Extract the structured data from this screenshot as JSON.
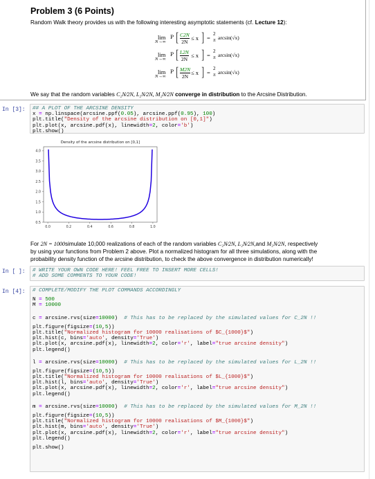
{
  "problem": {
    "title": "Problem 3 (6 Points)",
    "intro_prefix": "Random Walk theory provides us with the following interesting asymptotic statements (cf. ",
    "intro_bold": "Lecture 12",
    "intro_suffix": "):",
    "equations": [
      {
        "lim": "lim",
        "limsub": "N→∞",
        "prob": "P",
        "numerator": "C2N",
        "denominator": "2N",
        "relation": "≤ x",
        "equals": "=",
        "rhs_num": "2",
        "rhs_den": "π",
        "rhs_func": "arcsin(√x)"
      },
      {
        "lim": "lim",
        "limsub": "N→∞",
        "prob": "P",
        "numerator": "L2N",
        "denominator": "2N",
        "relation": "≤ x",
        "equals": "=",
        "rhs_num": "2",
        "rhs_den": "π",
        "rhs_func": "arcsin(√x)"
      },
      {
        "lim": "lim",
        "limsub": "N→∞",
        "prob": "P",
        "numerator": "M2N",
        "denominator": "2N",
        "relation": "≤ x",
        "equals": "=",
        "rhs_num": "2",
        "rhs_den": "π",
        "rhs_func": "arcsin(√x)"
      }
    ],
    "convergence_prefix": "We say that the random variables ",
    "convergence_vars": "C₂N⁄2N, L₂N⁄2N, M₂N⁄2N",
    "convergence_bold": "converge in distribution",
    "convergence_suffix": " to the Arcsine Distribution."
  },
  "cells": {
    "cell3": {
      "prompt": "In [3]:",
      "lines": [
        [
          {
            "t": "## A PLOT OF THE ARCSINE DENSITY",
            "c": "cm"
          }
        ],
        [
          {
            "t": "x "
          },
          {
            "t": "=",
            "c": "op"
          },
          {
            "t": " np.linspace(arcsine.ppf("
          },
          {
            "t": "0.05",
            "c": "num"
          },
          {
            "t": "), arcsine.ppf("
          },
          {
            "t": "0.95",
            "c": "num"
          },
          {
            "t": "), "
          },
          {
            "t": "100",
            "c": "num"
          },
          {
            "t": ")"
          }
        ],
        [
          {
            "t": "plt.title("
          },
          {
            "t": "\"Density of the arcsine distribution on [0,1]\"",
            "c": "str"
          },
          {
            "t": ")"
          }
        ],
        [
          {
            "t": "plt.plot(x, arcsine.pdf(x), linewidth"
          },
          {
            "t": "=",
            "c": "op"
          },
          {
            "t": "2",
            "c": "num"
          },
          {
            "t": ", color"
          },
          {
            "t": "=",
            "c": "op"
          },
          {
            "t": "'b'",
            "c": "str"
          },
          {
            "t": ")"
          }
        ],
        [
          {
            "t": "plt.show()"
          }
        ]
      ]
    },
    "task_text": {
      "prefix": "For ",
      "math1": "2N = 1000",
      "mid1": "simulate 10,000 realizations of each of the random variables ",
      "vars": "C₂N⁄2N, L₂N⁄2N,",
      "and": "and ",
      "var3": "M₂N⁄2N",
      "line1_end": ", respectively",
      "line2": "by using your functions from Problem 2 above. Plot a normalized histogram for all three simulations, along with the",
      "line3": "probability density function of the arcsine distribution, to check the above convergence in distribution numerically!"
    },
    "cell_empty": {
      "prompt": "In [ ]:",
      "lines": [
        [
          {
            "t": "# WRITE YOUR OWN CODE HERE! FEEL FREE TO INSERT MORE CELLS!",
            "c": "cm"
          }
        ],
        [
          {
            "t": "# ADD SOME COMMENTS TO YOUR CODE!",
            "c": "cm"
          }
        ]
      ]
    },
    "cell4": {
      "prompt": "In [4]:",
      "lines": [
        [
          {
            "t": "# COMPLETE/MODIFY THE PLOT COMMANDS ACCORDINGLY",
            "c": "cm"
          }
        ],
        [],
        [
          {
            "t": "N "
          },
          {
            "t": "=",
            "c": "op"
          },
          {
            "t": " "
          },
          {
            "t": "500",
            "c": "num"
          }
        ],
        [
          {
            "t": "M "
          },
          {
            "t": "=",
            "c": "op"
          },
          {
            "t": " "
          },
          {
            "t": "10000",
            "c": "num"
          }
        ],
        [],
        [],
        [
          {
            "t": "c "
          },
          {
            "t": "=",
            "c": "op"
          },
          {
            "t": " arcsine.rvs(size"
          },
          {
            "t": "=",
            "c": "op"
          },
          {
            "t": "10000",
            "c": "num"
          },
          {
            "t": ")  "
          },
          {
            "t": "# This has to be replaced by the simulated values for C_2N !!",
            "c": "cm"
          }
        ],
        [],
        [
          {
            "t": "plt.figure(figsize"
          },
          {
            "t": "=",
            "c": "op"
          },
          {
            "t": "("
          },
          {
            "t": "10",
            "c": "num"
          },
          {
            "t": ","
          },
          {
            "t": "5",
            "c": "num"
          },
          {
            "t": "))"
          }
        ],
        [
          {
            "t": "plt.title("
          },
          {
            "t": "\"Normalized histogram for 10000 realisations of $C_{1000}$\"",
            "c": "str"
          },
          {
            "t": ")"
          }
        ],
        [
          {
            "t": "plt.hist(c, bins"
          },
          {
            "t": "=",
            "c": "op"
          },
          {
            "t": "'auto'",
            "c": "str"
          },
          {
            "t": ", density"
          },
          {
            "t": "=",
            "c": "op"
          },
          {
            "t": "'True'",
            "c": "str"
          },
          {
            "t": ")"
          }
        ],
        [
          {
            "t": "plt.plot(x, arcsine.pdf(x), linewidth"
          },
          {
            "t": "=",
            "c": "op"
          },
          {
            "t": "2",
            "c": "num"
          },
          {
            "t": ", color"
          },
          {
            "t": "=",
            "c": "op"
          },
          {
            "t": "'r'",
            "c": "str"
          },
          {
            "t": ", label"
          },
          {
            "t": "=",
            "c": "op"
          },
          {
            "t": "\"true arcsine density\"",
            "c": "str"
          },
          {
            "t": ")"
          }
        ],
        [
          {
            "t": "plt.legend()"
          }
        ],
        [],
        [],
        [
          {
            "t": "l "
          },
          {
            "t": "=",
            "c": "op"
          },
          {
            "t": " arcsine.rvs(size"
          },
          {
            "t": "=",
            "c": "op"
          },
          {
            "t": "10000",
            "c": "num"
          },
          {
            "t": ")  "
          },
          {
            "t": "# This has to be replaced by the simulated values for L_2N !!",
            "c": "cm"
          }
        ],
        [],
        [
          {
            "t": "plt.figure(figsize"
          },
          {
            "t": "=",
            "c": "op"
          },
          {
            "t": "("
          },
          {
            "t": "10",
            "c": "num"
          },
          {
            "t": ","
          },
          {
            "t": "5",
            "c": "num"
          },
          {
            "t": "))"
          }
        ],
        [
          {
            "t": "plt.title("
          },
          {
            "t": "\"Normalized histogram for 10000 realisations of $L_{1000}$\"",
            "c": "str"
          },
          {
            "t": ")"
          }
        ],
        [
          {
            "t": "plt.hist(l, bins"
          },
          {
            "t": "=",
            "c": "op"
          },
          {
            "t": "'auto'",
            "c": "str"
          },
          {
            "t": ", density"
          },
          {
            "t": "=",
            "c": "op"
          },
          {
            "t": "'True'",
            "c": "str"
          },
          {
            "t": ")"
          }
        ],
        [
          {
            "t": "plt.plot(x, arcsine.pdf(x), linewidth"
          },
          {
            "t": "=",
            "c": "op"
          },
          {
            "t": "2",
            "c": "num"
          },
          {
            "t": ", color"
          },
          {
            "t": "=",
            "c": "op"
          },
          {
            "t": "'r'",
            "c": "str"
          },
          {
            "t": ", label"
          },
          {
            "t": "=",
            "c": "op"
          },
          {
            "t": "\"true arcsine density\"",
            "c": "str"
          },
          {
            "t": ")"
          }
        ],
        [
          {
            "t": "plt.legend()"
          }
        ],
        [],
        [],
        [
          {
            "t": "m "
          },
          {
            "t": "=",
            "c": "op"
          },
          {
            "t": " arcsine.rvs(size"
          },
          {
            "t": "=",
            "c": "op"
          },
          {
            "t": "10000",
            "c": "num"
          },
          {
            "t": ")  "
          },
          {
            "t": "# This has to be replaced by the simulated values for M_2N !!",
            "c": "cm"
          }
        ],
        [],
        [
          {
            "t": "plt.figure(figsize"
          },
          {
            "t": "=",
            "c": "op"
          },
          {
            "t": "("
          },
          {
            "t": "10",
            "c": "num"
          },
          {
            "t": ","
          },
          {
            "t": "5",
            "c": "num"
          },
          {
            "t": "))"
          }
        ],
        [
          {
            "t": "plt.title("
          },
          {
            "t": "\"Normalized histogram for 10000 realisations of $M_{1000}$\"",
            "c": "str"
          },
          {
            "t": ")"
          }
        ],
        [
          {
            "t": "plt.hist(m, bins"
          },
          {
            "t": "=",
            "c": "op"
          },
          {
            "t": "'auto'",
            "c": "str"
          },
          {
            "t": ", density"
          },
          {
            "t": "=",
            "c": "op"
          },
          {
            "t": "'True'",
            "c": "str"
          },
          {
            "t": ")"
          }
        ],
        [
          {
            "t": "plt.plot(x, arcsine.pdf(x), linewidth"
          },
          {
            "t": "=",
            "c": "op"
          },
          {
            "t": "2",
            "c": "num"
          },
          {
            "t": ", color"
          },
          {
            "t": "=",
            "c": "op"
          },
          {
            "t": "'r'",
            "c": "str"
          },
          {
            "t": ", label"
          },
          {
            "t": "=",
            "c": "op"
          },
          {
            "t": "\"true arcsine density\"",
            "c": "str"
          },
          {
            "t": ")"
          }
        ],
        [
          {
            "t": "plt.legend()"
          }
        ],
        [],
        [
          {
            "t": "plt.show()"
          }
        ]
      ]
    }
  },
  "chart_data": {
    "type": "line",
    "title": "Density of the arcsine distribution on [0,1]",
    "xlabel": "",
    "ylabel": "",
    "function": "arcsine.pdf(x) = 1/(pi*sqrt(x*(1-x)))",
    "x_range": [
      0.00616,
      0.99384
    ],
    "n_points": 100,
    "xlim": [
      -0.04,
      1.04
    ],
    "ylim": [
      0.5,
      4.2
    ],
    "xticks": [
      "0.0",
      "0.2",
      "0.4",
      "0.6",
      "0.8",
      "1.0"
    ],
    "xtick_values": [
      0.0,
      0.2,
      0.4,
      0.6,
      0.8,
      1.0
    ],
    "yticks": [
      "0.5",
      "1.0",
      "1.5",
      "2.0",
      "2.5",
      "3.0",
      "3.5",
      "4.0"
    ],
    "ytick_values": [
      0.5,
      1.0,
      1.5,
      2.0,
      2.5,
      3.0,
      3.5,
      4.0
    ],
    "line_color": "#1f00e0",
    "grid": false,
    "legend": "none"
  }
}
